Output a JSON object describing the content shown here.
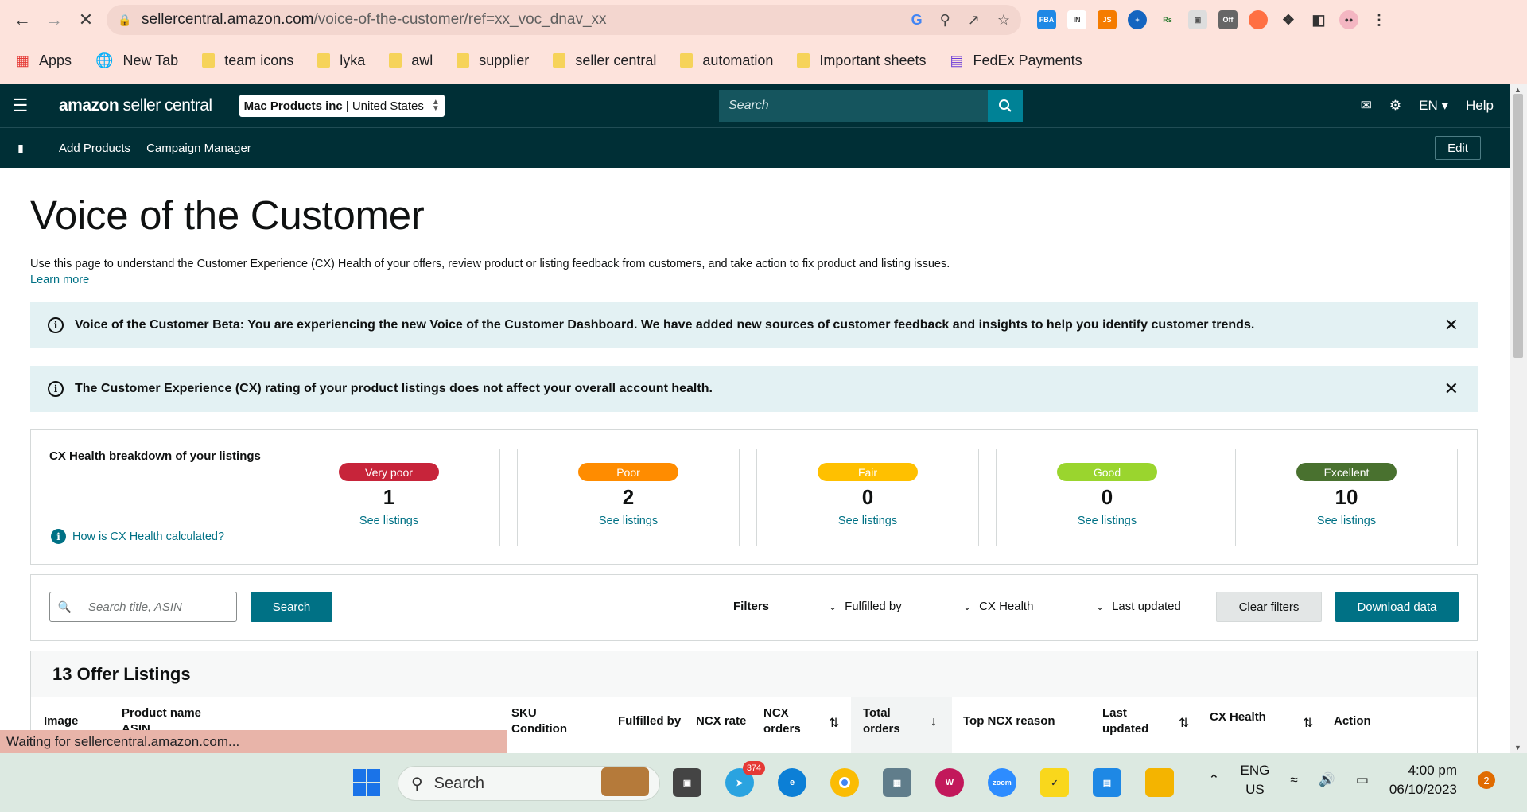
{
  "browser": {
    "url_domain": "sellercentral.amazon.com",
    "url_path": "/voice-of-the-customer/ref=xx_voc_dnav_xx",
    "bookmarks": [
      "Apps",
      "New Tab",
      "team icons",
      "lyka",
      "awl",
      "supplier",
      "seller central",
      "automation",
      "Important sheets",
      "FedEx Payments"
    ],
    "status_text": "Waiting for sellercentral.amazon.com..."
  },
  "header": {
    "logo_bold": "amazon",
    "logo_rest": " seller central",
    "account_name": "Mac Products inc",
    "account_region": " | United States",
    "search_placeholder": "Search",
    "lang": "EN",
    "help": "Help",
    "sub_links": [
      "Add Products",
      "Campaign Manager"
    ],
    "edit": "Edit"
  },
  "page": {
    "title": "Voice of the Customer",
    "description": "Use this page to understand the Customer Experience (CX) Health of your offers, review product or listing feedback from customers, and take action to fix product and listing issues.",
    "learn_more": "Learn more",
    "alerts": [
      "Voice of the Customer Beta: You are experiencing the new Voice of the Customer Dashboard. We have added new sources of customer feedback and insights to help you identify customer trends.",
      "The Customer Experience (CX) rating of your product listings does not affect your overall account health."
    ]
  },
  "cx_health": {
    "title": "CX Health breakdown of your listings",
    "how_link": "How is CX Health calculated?",
    "tiles": [
      {
        "label": "Very poor",
        "count": "1",
        "link": "See listings",
        "color": "#c7243a"
      },
      {
        "label": "Poor",
        "count": "2",
        "link": "See listings",
        "color": "#ff8c00"
      },
      {
        "label": "Fair",
        "count": "0",
        "link": "See listings",
        "color": "#ffc000"
      },
      {
        "label": "Good",
        "count": "0",
        "link": "See listings",
        "color": "#9ad52e"
      },
      {
        "label": "Excellent",
        "count": "10",
        "link": "See listings",
        "color": "#49712f"
      }
    ]
  },
  "filters": {
    "search_placeholder": "Search title, ASIN",
    "search_button": "Search",
    "label": "Filters",
    "dropdowns": [
      "Fulfilled by",
      "CX Health",
      "Last updated"
    ],
    "clear": "Clear filters",
    "download": "Download data"
  },
  "listings": {
    "heading": "13 Offer Listings",
    "columns": {
      "image": "Image",
      "product_name": "Product name",
      "product_sub": "ASIN",
      "sku": "SKU",
      "condition": "Condition",
      "fulfilled_by": "Fulfilled by",
      "ncx_rate": "NCX rate",
      "ncx_orders_1": "NCX",
      "ncx_orders_2": "orders",
      "total_orders_1": "Total",
      "total_orders_2": "orders",
      "top_reason": "Top NCX reason",
      "last_updated_1": "Last",
      "last_updated_2": "updated",
      "cx_health": "CX Health",
      "action": "Action"
    }
  },
  "taskbar": {
    "search": "Search",
    "telegram_badge": "374",
    "lang_1": "ENG",
    "lang_2": "US",
    "time": "4:00 pm",
    "date": "06/10/2023",
    "notifications": "2"
  }
}
